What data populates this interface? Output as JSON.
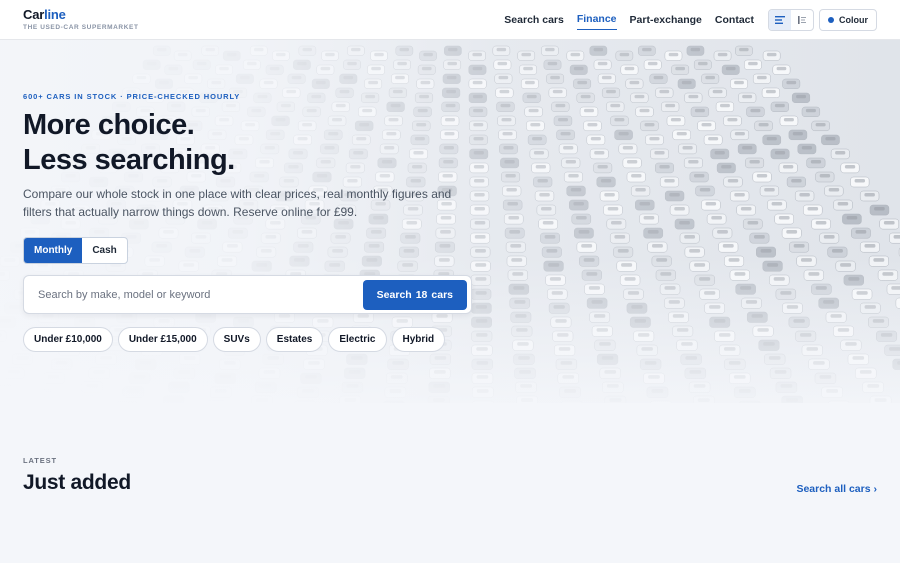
{
  "brand": {
    "name_part1": "Car",
    "name_part2": "line",
    "tagline": "THE USED-CAR SUPERMARKET"
  },
  "nav": {
    "items": [
      {
        "label": "Search cars",
        "active": false
      },
      {
        "label": "Finance",
        "active": true
      },
      {
        "label": "Part-exchange",
        "active": false
      },
      {
        "label": "Contact",
        "active": false
      }
    ],
    "colour_label": "Colour"
  },
  "hero": {
    "eyebrow": "600+ CARS IN STOCK · PRICE-CHECKED HOURLY",
    "headline_line1": "More choice.",
    "headline_line2": "Less searching.",
    "subcopy": "Compare our whole stock in one place with clear prices, real monthly figures and filters that actually narrow things down. Reserve online for £99.",
    "payment_options": [
      "Monthly",
      "Cash"
    ],
    "payment_selected": "Monthly",
    "search_placeholder": "Search by make, model or keyword",
    "search_button_prefix": "Search",
    "search_button_count": "18",
    "search_button_suffix": "cars",
    "chips": [
      "Under £10,000",
      "Under £15,000",
      "SUVs",
      "Estates",
      "Electric",
      "Hybrid"
    ]
  },
  "latest": {
    "label": "LATEST",
    "title": "Just added",
    "link": "Search all cars ›"
  },
  "colors": {
    "accent": "#1d5fbf",
    "text": "#111827",
    "muted": "#6b7280",
    "background": "#f4f6fa"
  }
}
